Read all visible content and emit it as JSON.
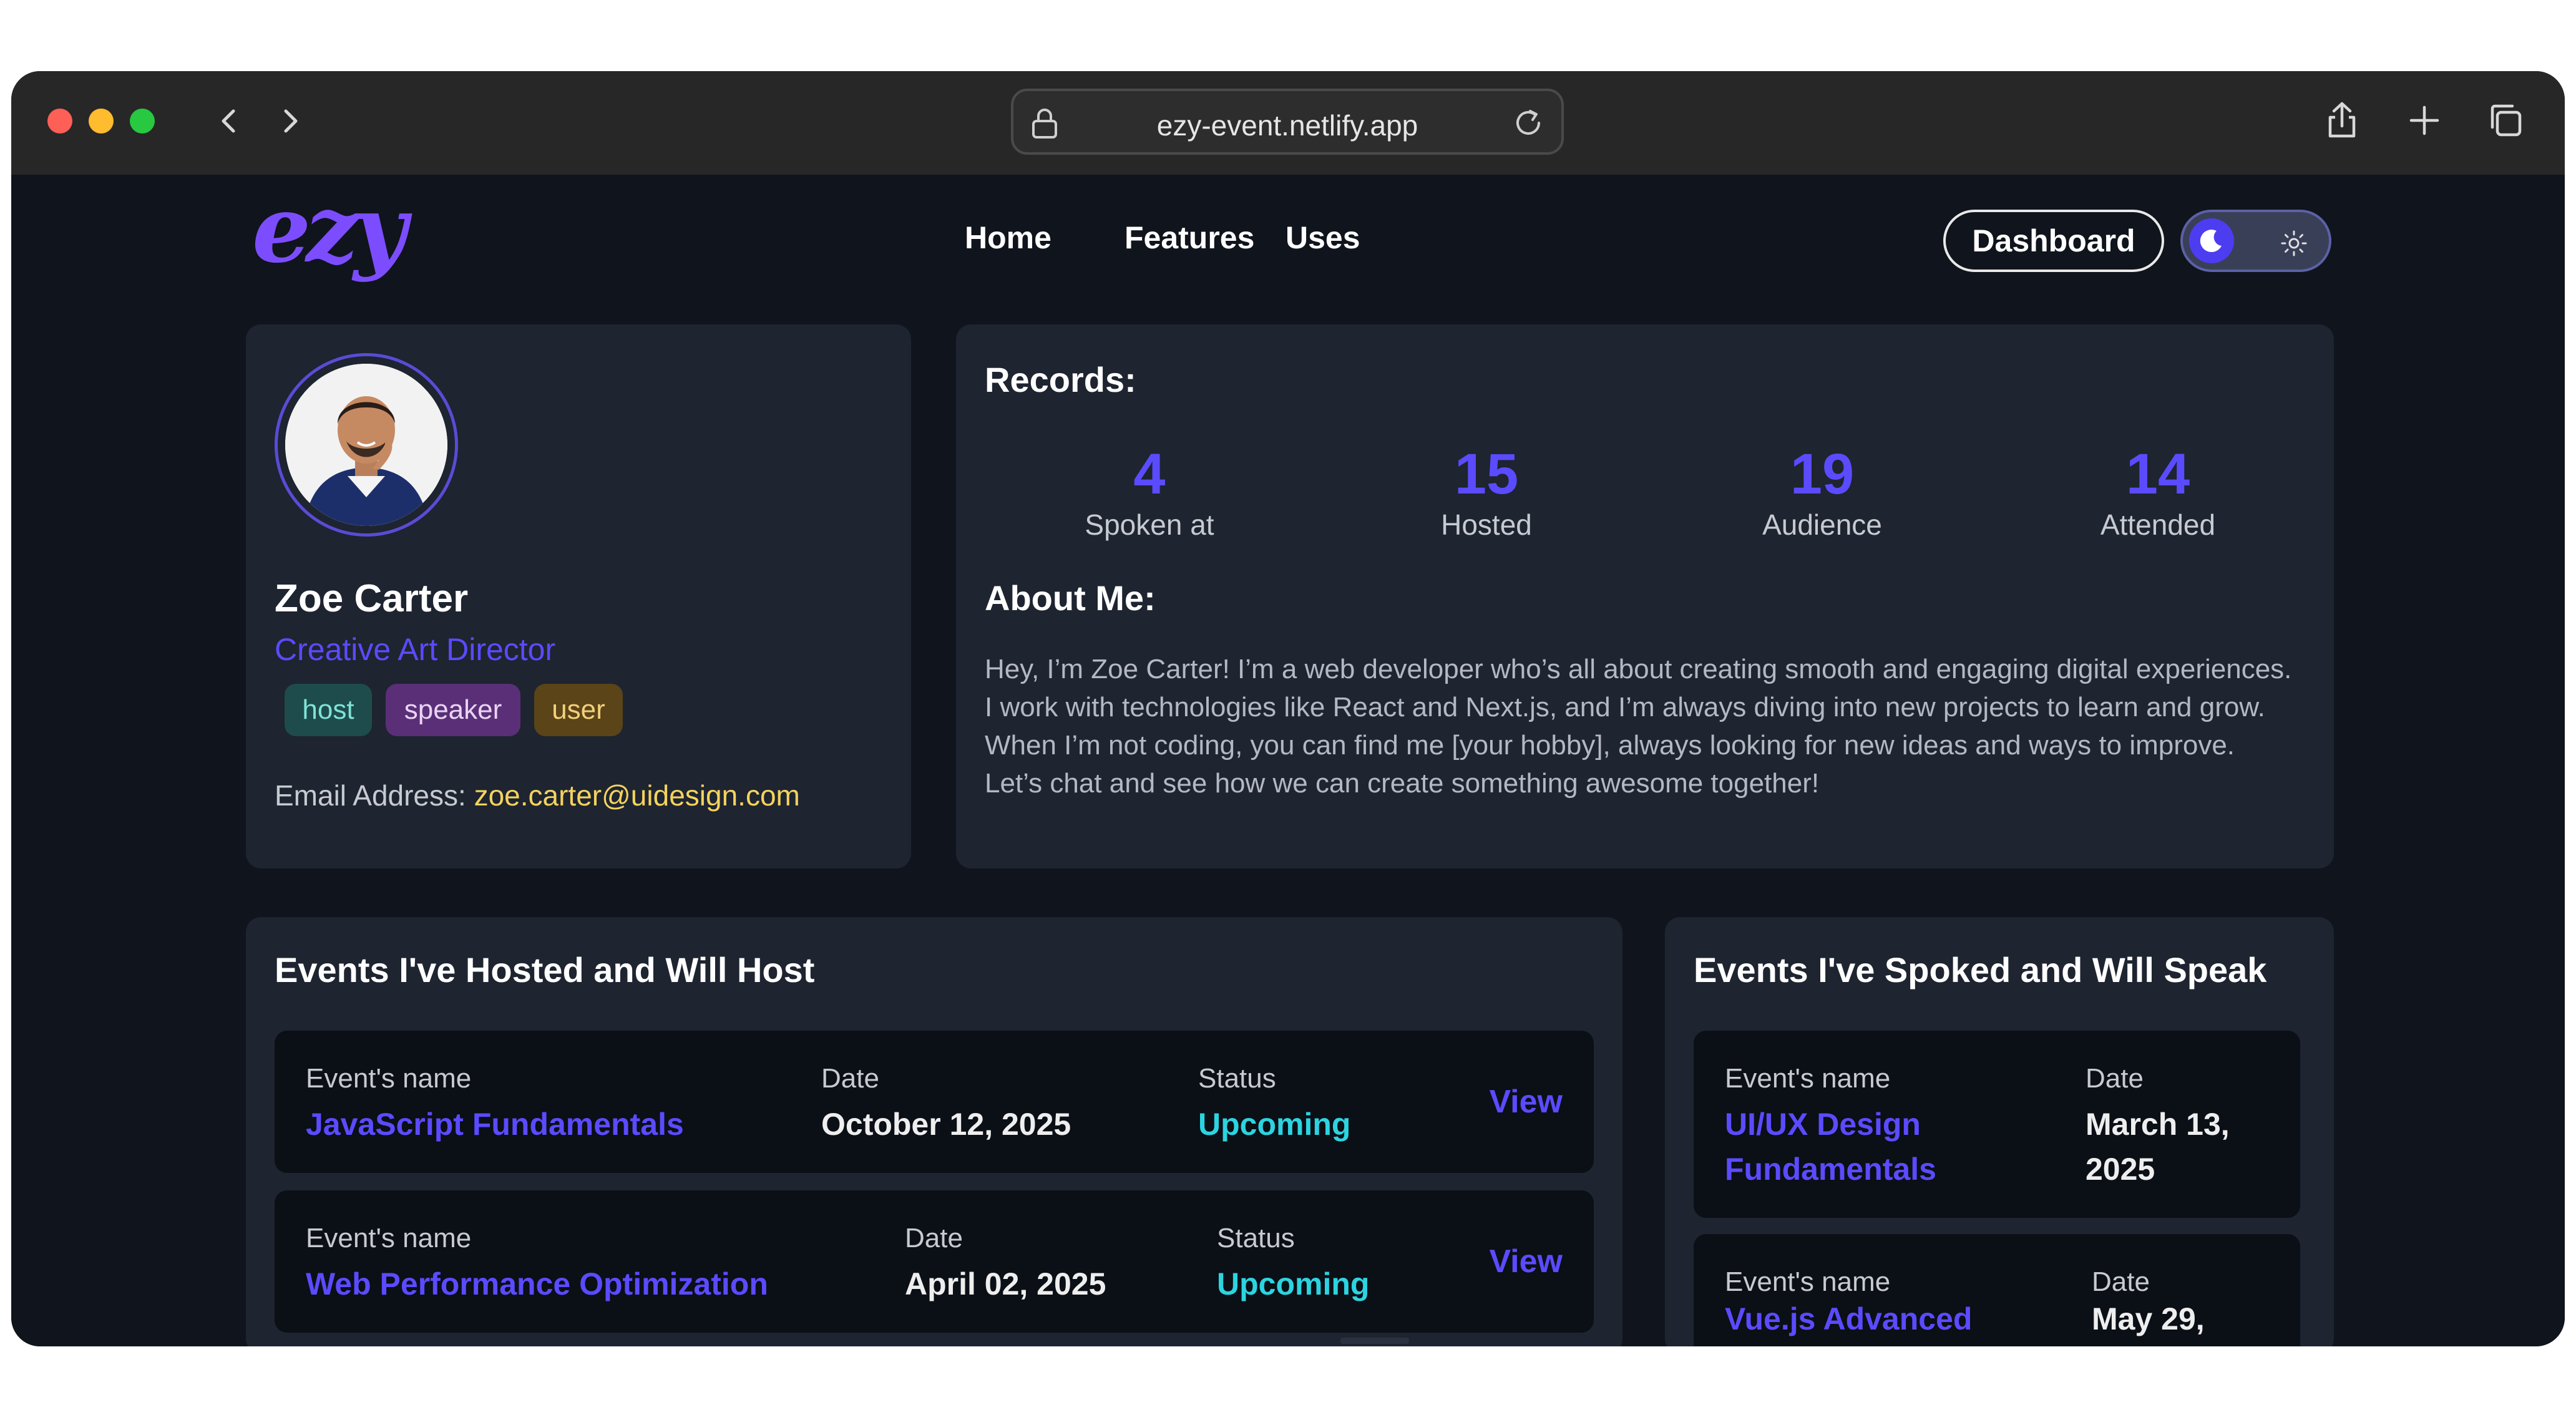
{
  "browser": {
    "url": "ezy-event.netlify.app"
  },
  "header": {
    "logo_text": "ezy",
    "nav": [
      "Home",
      "Features",
      "Uses"
    ],
    "dashboard_label": "Dashboard",
    "theme": "dark"
  },
  "profile": {
    "name": "Zoe Carter",
    "title": "Creative Art Director",
    "tags": [
      "host",
      "speaker",
      "user"
    ],
    "email_label": "Email Address:",
    "email": "zoe.carter@uidesign.com"
  },
  "records": {
    "title": "Records:",
    "stats": [
      {
        "value": "4",
        "label": "Spoken at"
      },
      {
        "value": "15",
        "label": "Hosted"
      },
      {
        "value": "19",
        "label": "Audience"
      },
      {
        "value": "14",
        "label": "Attended"
      }
    ],
    "about_title": "About Me:",
    "about_text": "Hey, I’m Zoe Carter! I’m a web developer who’s all about creating smooth and engaging digital experiences. I work with technologies like React and Next.js, and I’m always diving into new projects to learn and grow. When I’m not coding, you can find me [your hobby], always looking for new ideas and ways to improve. Let’s chat and see how we can create something awesome together!"
  },
  "hosted": {
    "title": "Events I've Hosted and Will Host",
    "labels": {
      "name": "Event's name",
      "date": "Date",
      "status": "Status",
      "view": "View"
    },
    "events": [
      {
        "name": "JavaScript Fundamentals",
        "date": "October 12, 2025",
        "status": "Upcoming"
      },
      {
        "name": "Web Performance Optimization",
        "date": "April 02, 2025",
        "status": "Upcoming"
      }
    ]
  },
  "spoke": {
    "title": "Events I've Spoked and Will Speak",
    "labels": {
      "name": "Event's name",
      "date": "Date"
    },
    "events": [
      {
        "name_line1": "UI/UX Design",
        "name_line2": "Fundamentals",
        "date_line1": "March 13,",
        "date_line2": "2025"
      },
      {
        "name_line1": "Vue.js Advanced",
        "date_line1": "May 29,"
      }
    ]
  },
  "colors": {
    "accent": "#5b4bff",
    "status_upcoming": "#2bd4e0",
    "email": "#f4d35e"
  }
}
